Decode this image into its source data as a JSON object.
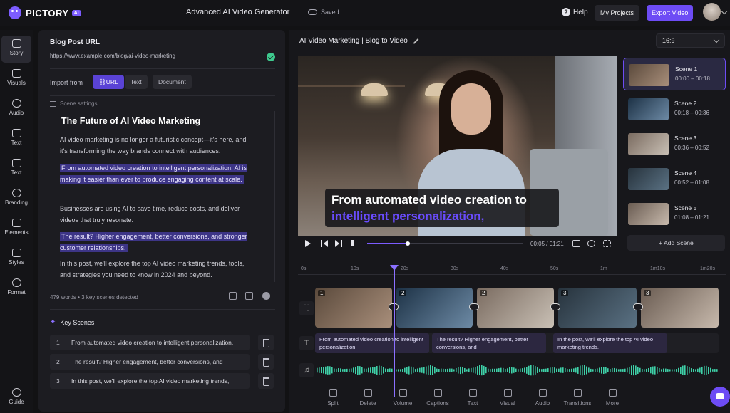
{
  "header": {
    "logo_text": "PICTORY",
    "logo_badge": "AI",
    "app_title": "Advanced AI Video Generator",
    "save_status": "Saved",
    "help_label": "Help",
    "projects_label": "My Projects",
    "export_label": "Export Video",
    "accent_color": "#6d4cf5"
  },
  "rail": {
    "items": [
      {
        "label": "Story",
        "icon": "story-icon",
        "active": true
      },
      {
        "label": "Visuals",
        "icon": "visuals-icon"
      },
      {
        "label": "Audio",
        "icon": "music-note-icon"
      },
      {
        "label": "Text",
        "icon": "text-icon"
      },
      {
        "label": "Text",
        "icon": "text-box-icon"
      },
      {
        "label": "Branding",
        "icon": "branding-icon"
      },
      {
        "label": "Elements",
        "icon": "elements-icon"
      },
      {
        "label": "Styles",
        "icon": "styles-icon"
      },
      {
        "label": "Format",
        "icon": "format-icon"
      }
    ],
    "guide_label": "Guide"
  },
  "story": {
    "blog_url_label": "Blog Post URL",
    "blog_url": "https://www.example.com/blog/ai-video-marketing",
    "import_label": "Import from",
    "import_tabs": [
      "URL",
      "Text",
      "Document"
    ],
    "scene_settings_label": "Scene settings",
    "doc_title": "The Future of AI Video Marketing",
    "paragraphs": [
      {
        "text": "AI video marketing is no longer a futuristic concept—it's here, and it's transforming the way brands connect with audiences.",
        "highlight": false
      },
      {
        "text": "From automated video creation to intelligent personalization, AI is making it easier than ever to produce engaging content at scale.",
        "highlight": true
      },
      {
        "text": "Businesses are using AI to save time, reduce costs, and deliver videos that truly resonate.",
        "highlight": false
      },
      {
        "text": "The result? Higher engagement, better conversions, and stronger customer relationships.",
        "highlight": true
      },
      {
        "text": "In this post, we'll explore the top AI video marketing trends, tools, and strategies you need to know in 2024 and beyond.",
        "highlight": false
      }
    ],
    "word_count_text": "479 words • 3 key scenes detected",
    "key_scenes_label": "Key Scenes",
    "key_scenes": [
      {
        "num": "1",
        "text": "From automated video creation to intelligent personalization,"
      },
      {
        "num": "2",
        "text": "The result? Higher engagement, better conversions, and"
      },
      {
        "num": "3",
        "text": "In this post, we'll explore the top AI video marketing trends,"
      }
    ]
  },
  "editor": {
    "project_title": "AI Video Marketing | Blog to Video",
    "aspect_ratio": "16:9",
    "caption_line1": "From automated video creation to",
    "caption_line2": "intelligent personalization,",
    "caption_highlight_color": "#6a4cff",
    "time_display": "00:05 / 01:21",
    "playback_fraction": 0.26,
    "scenes": [
      {
        "name": "Scene 1",
        "time": "00:00 – 00:18",
        "active": true
      },
      {
        "name": "Scene 2",
        "time": "00:18 – 00:36",
        "active": false
      },
      {
        "name": "Scene 3",
        "time": "00:36 – 00:52",
        "active": false
      },
      {
        "name": "Scene 4",
        "time": "00:52 – 01:08",
        "active": false
      },
      {
        "name": "Scene 5",
        "time": "01:08 – 01:21",
        "active": false
      }
    ],
    "add_scene_label": "+ Add Scene"
  },
  "timeline": {
    "ruler_labels": [
      "0s",
      "10s",
      "20s",
      "30s",
      "40s",
      "50s",
      "1m",
      "1m10s",
      "1m20s"
    ],
    "clip_numbers": [
      "1",
      "2",
      "2",
      "3",
      "3"
    ],
    "text_clips": [
      "From automated video creation to intelligent personalization,",
      "The result? Higher engagement, better conversions, and",
      "In the post, we'll explore the top AI video marketing trends."
    ],
    "tools": [
      "Split",
      "Delete",
      "Volume",
      "Captions",
      "Text",
      "Visual",
      "Audio",
      "Transitions",
      "More"
    ]
  }
}
